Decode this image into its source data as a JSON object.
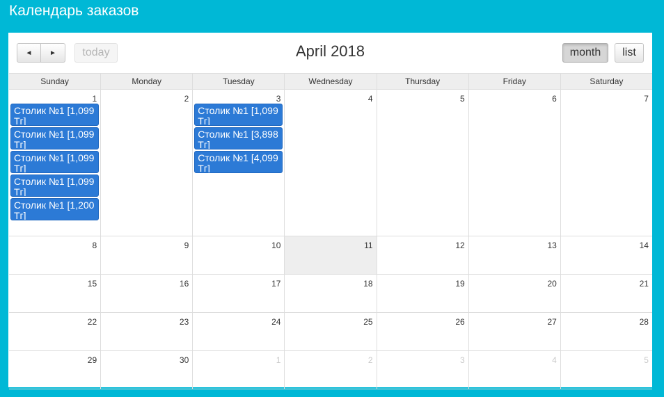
{
  "app": {
    "title": "Календарь заказов"
  },
  "toolbar": {
    "prev_icon": "◄",
    "next_icon": "►",
    "today_label": "today",
    "title": "April 2018",
    "month_label": "month",
    "list_label": "list"
  },
  "days_of_week": [
    "Sunday",
    "Monday",
    "Tuesday",
    "Wednesday",
    "Thursday",
    "Friday",
    "Saturday"
  ],
  "weeks": [
    [
      {
        "num": "1",
        "other": false,
        "events": [
          "Столик №1 [1,099 Тг]",
          "Столик №1 [1,099 Тг]",
          "Столик №1 [1,099 Тг]",
          "Столик №1 [1,099 Тг]",
          "Столик №1 [1,200 Тг]"
        ]
      },
      {
        "num": "2",
        "other": false,
        "events": []
      },
      {
        "num": "3",
        "other": false,
        "events": [
          "Столик №1 [1,099 Тг]",
          "Столик №1 [3,898 Тг]",
          "Столик №1 [4,099 Тг]"
        ]
      },
      {
        "num": "4",
        "other": false,
        "events": []
      },
      {
        "num": "5",
        "other": false,
        "events": []
      },
      {
        "num": "6",
        "other": false,
        "events": []
      },
      {
        "num": "7",
        "other": false,
        "events": []
      }
    ],
    [
      {
        "num": "8",
        "other": false,
        "events": []
      },
      {
        "num": "9",
        "other": false,
        "events": []
      },
      {
        "num": "10",
        "other": false,
        "events": []
      },
      {
        "num": "11",
        "other": false,
        "today": true,
        "events": []
      },
      {
        "num": "12",
        "other": false,
        "events": []
      },
      {
        "num": "13",
        "other": false,
        "events": []
      },
      {
        "num": "14",
        "other": false,
        "events": []
      }
    ],
    [
      {
        "num": "15",
        "other": false,
        "events": []
      },
      {
        "num": "16",
        "other": false,
        "events": []
      },
      {
        "num": "17",
        "other": false,
        "events": []
      },
      {
        "num": "18",
        "other": false,
        "events": []
      },
      {
        "num": "19",
        "other": false,
        "events": []
      },
      {
        "num": "20",
        "other": false,
        "events": []
      },
      {
        "num": "21",
        "other": false,
        "events": []
      }
    ],
    [
      {
        "num": "22",
        "other": false,
        "events": []
      },
      {
        "num": "23",
        "other": false,
        "events": []
      },
      {
        "num": "24",
        "other": false,
        "events": []
      },
      {
        "num": "25",
        "other": false,
        "events": []
      },
      {
        "num": "26",
        "other": false,
        "events": []
      },
      {
        "num": "27",
        "other": false,
        "events": []
      },
      {
        "num": "28",
        "other": false,
        "events": []
      }
    ],
    [
      {
        "num": "29",
        "other": false,
        "events": []
      },
      {
        "num": "30",
        "other": false,
        "events": []
      },
      {
        "num": "1",
        "other": true,
        "events": []
      },
      {
        "num": "2",
        "other": true,
        "events": []
      },
      {
        "num": "3",
        "other": true,
        "events": []
      },
      {
        "num": "4",
        "other": true,
        "events": []
      },
      {
        "num": "5",
        "other": true,
        "events": []
      }
    ]
  ],
  "colors": {
    "frame": "#00b8d6",
    "event": "#2c7ad6",
    "today": "#eeeeee"
  }
}
